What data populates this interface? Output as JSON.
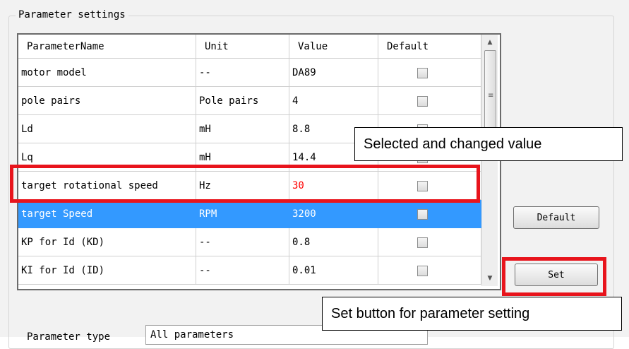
{
  "group": {
    "title": "Parameter settings"
  },
  "table": {
    "columns": [
      "ParameterName",
      "Unit",
      "Value",
      "Default"
    ],
    "rows": [
      {
        "name": "motor model",
        "unit": "--",
        "value": "DA89",
        "default": false
      },
      {
        "name": "pole pairs",
        "unit": "Pole pairs",
        "value": "4",
        "default": false
      },
      {
        "name": "Ld",
        "unit": "mH",
        "value": "8.8",
        "default": false
      },
      {
        "name": "Lq",
        "unit": "mH",
        "value": "14.4",
        "default": false
      },
      {
        "name": "target rotational speed",
        "unit": "Hz",
        "value": "30",
        "default": false,
        "changed": true
      },
      {
        "name": "target Speed",
        "unit": "RPM",
        "value": "3200",
        "default": false,
        "selected": true
      },
      {
        "name": "KP for Id (KD)",
        "unit": "--",
        "value": "0.8",
        "default": false
      },
      {
        "name": "KI for Id (ID)",
        "unit": "--",
        "value": "0.01",
        "default": false
      }
    ]
  },
  "buttons": {
    "default_label": "Default",
    "set_label": "Set"
  },
  "parameter_type": {
    "label": "Parameter type",
    "value": "All parameters"
  },
  "callouts": {
    "changed": "Selected and changed value",
    "set": "Set button for parameter setting"
  },
  "colors": {
    "highlight": "#e8141c",
    "selection": "#3399ff",
    "changed_value": "#ff0000"
  },
  "icons": {
    "scroll_up": "triangle-up",
    "scroll_down": "triangle-down",
    "grip": "grip-lines"
  }
}
